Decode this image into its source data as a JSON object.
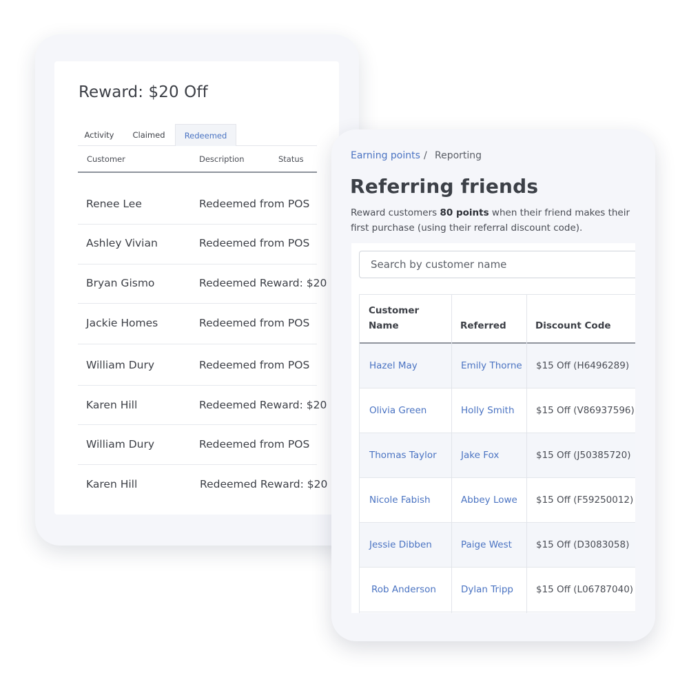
{
  "reward_card": {
    "title": "Reward: $20 Off",
    "tabs": [
      {
        "label": "Activity",
        "active": false
      },
      {
        "label": "Claimed",
        "active": false
      },
      {
        "label": "Redeemed",
        "active": true
      }
    ],
    "columns": [
      "Customer",
      "Description",
      "Status"
    ],
    "rows": [
      {
        "customer": "Renee Lee",
        "description": "Redeemed from POS"
      },
      {
        "customer": "Ashley Vivian",
        "description": "Redeemed from POS"
      },
      {
        "customer": "Bryan Gismo",
        "description": "Redeemed Reward: $20"
      },
      {
        "customer": "Jackie Homes",
        "description": "Redeemed from POS"
      },
      {
        "customer": "William Dury",
        "description": "Redeemed from POS"
      },
      {
        "customer": "Karen Hill",
        "description": "Redeemed Reward: $20"
      },
      {
        "customer": "William Dury",
        "description": "Redeemed from POS"
      },
      {
        "customer": "Karen Hill",
        "description": "Redeemed Reward: $20"
      }
    ]
  },
  "referral_card": {
    "breadcrumb": {
      "link": "Earning points",
      "separator": "/",
      "current": "Reporting"
    },
    "title": "Referring friends",
    "description": {
      "before": "Reward customers ",
      "points": "80 points",
      "after": " when their friend makes their first purchase (using their referral discount code)."
    },
    "search": {
      "placeholder": "Search by customer name"
    },
    "columns": {
      "customer_name": "Customer Name",
      "referred": "Referred",
      "discount_code": "Discount Code"
    },
    "rows": [
      {
        "customer": "Hazel May",
        "referred": "Emily Thorne",
        "code": "$15 Off (H6496289)"
      },
      {
        "customer": "Olivia Green",
        "referred": "Holly Smith",
        "code": "$15 Off (V86937596)"
      },
      {
        "customer": "Thomas Taylor",
        "referred": "Jake Fox",
        "code": "$15 Off (J50385720)"
      },
      {
        "customer": "Nicole Fabish",
        "referred": "Abbey Lowe",
        "code": "$15 Off (F59250012)"
      },
      {
        "customer": "Jessie Dibben",
        "referred": "Paige West",
        "code": "$15 Off (D3083058)"
      },
      {
        "customer": "Rob Anderson",
        "referred": "Dylan Tripp",
        "code": "$15 Off (L06787040)"
      }
    ]
  },
  "colors": {
    "link": "#4a73c2",
    "card_bg": "#f5f6fa",
    "text": "#3c3f46"
  }
}
